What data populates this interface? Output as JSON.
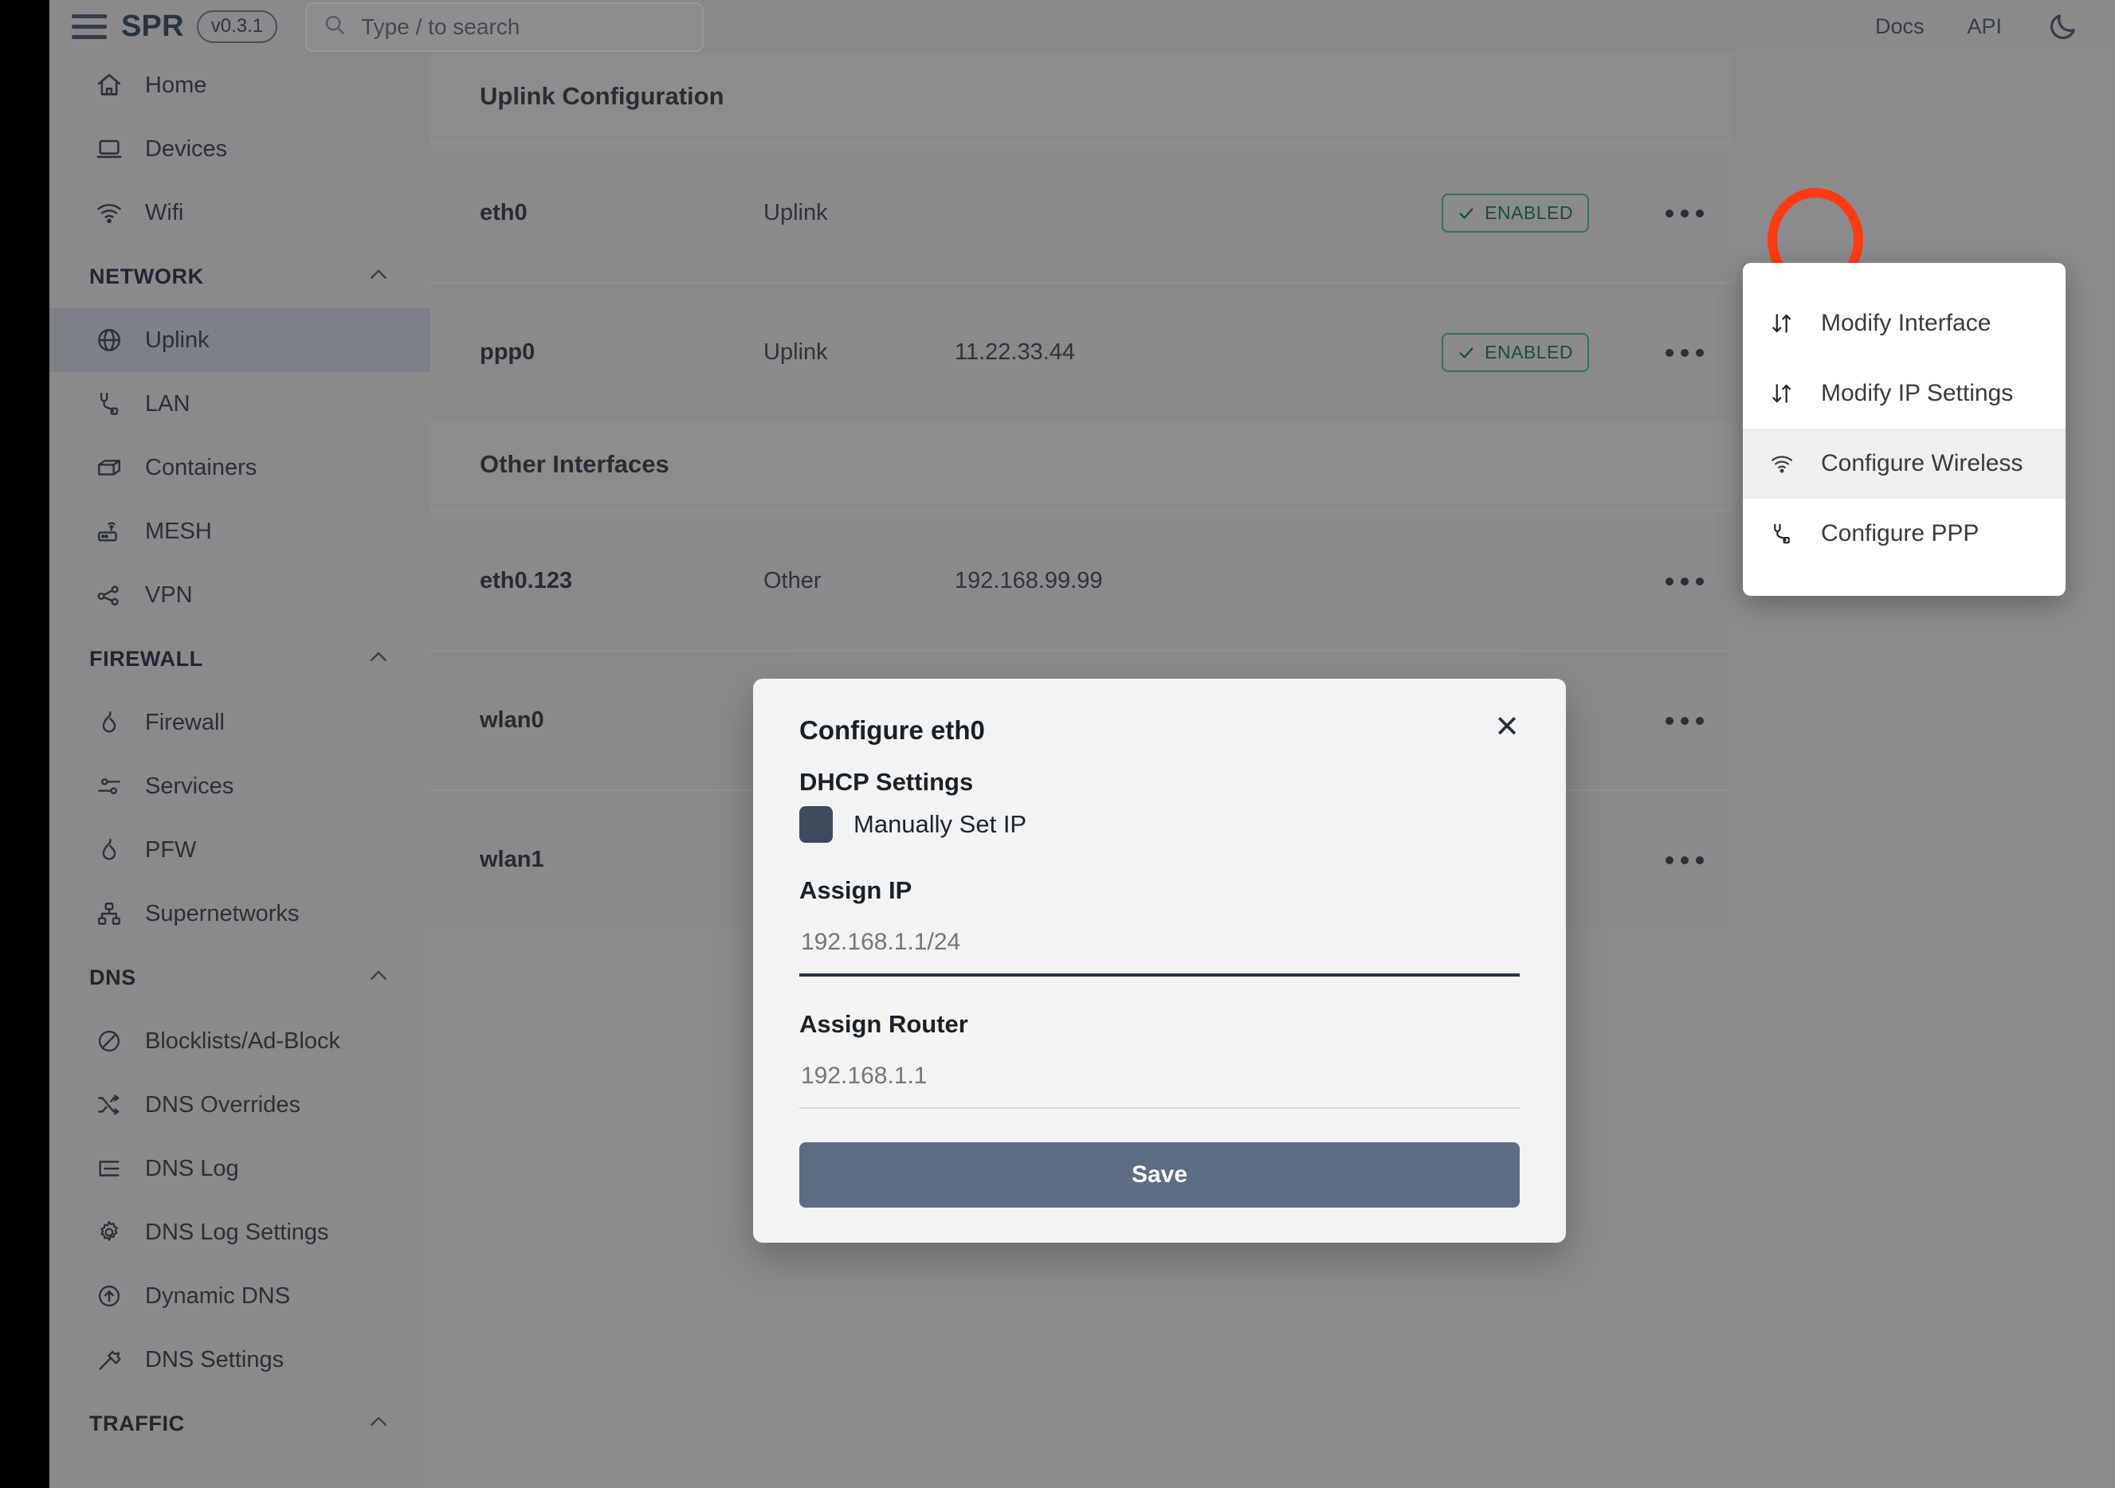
{
  "header": {
    "brand": "SPR",
    "version": "v0.3.1",
    "search_placeholder": "Type / to search",
    "links": [
      "Docs",
      "API"
    ],
    "theme_toggle_icon": "moon-icon",
    "menu_icon": "hamburger-icon",
    "search_icon": "search-icon"
  },
  "sidebar": {
    "top_items": [
      {
        "label": "Home",
        "icon": "home-icon"
      },
      {
        "label": "Devices",
        "icon": "laptop-icon"
      },
      {
        "label": "Wifi",
        "icon": "wifi-icon"
      }
    ],
    "groups": [
      {
        "title": "NETWORK",
        "collapse_icon": "chevron-up-icon",
        "items": [
          {
            "label": "Uplink",
            "icon": "globe-icon",
            "active": true
          },
          {
            "label": "LAN",
            "icon": "plug-icon",
            "active": false
          },
          {
            "label": "Containers",
            "icon": "box-icon",
            "active": false
          },
          {
            "label": "MESH",
            "icon": "router-icon",
            "active": false
          },
          {
            "label": "VPN",
            "icon": "share-nodes-icon",
            "active": false
          }
        ]
      },
      {
        "title": "FIREWALL",
        "collapse_icon": "chevron-up-icon",
        "items": [
          {
            "label": "Firewall",
            "icon": "flame-icon",
            "active": false
          },
          {
            "label": "Services",
            "icon": "sliders-icon",
            "active": false
          },
          {
            "label": "PFW",
            "icon": "flame-icon",
            "active": false
          },
          {
            "label": "Supernetworks",
            "icon": "network-tree-icon",
            "active": false
          }
        ]
      },
      {
        "title": "DNS",
        "collapse_icon": "chevron-up-icon",
        "items": [
          {
            "label": "Blocklists/Ad-Block",
            "icon": "block-icon",
            "active": false
          },
          {
            "label": "DNS Overrides",
            "icon": "shuffle-icon",
            "active": false
          },
          {
            "label": "DNS Log",
            "icon": "list-icon",
            "active": false
          },
          {
            "label": "DNS Log Settings",
            "icon": "gear-icon",
            "active": false
          },
          {
            "label": "Dynamic DNS",
            "icon": "arrow-up-circle-icon",
            "active": false
          },
          {
            "label": "DNS Settings",
            "icon": "hammer-icon",
            "active": false
          }
        ]
      },
      {
        "title": "TRAFFIC",
        "collapse_icon": "chevron-up-icon",
        "items": []
      }
    ]
  },
  "main": {
    "uplink_section_title": "Uplink Configuration",
    "other_section_title": "Other Interfaces",
    "uplink_rows": [
      {
        "name": "eth0",
        "type": "Uplink",
        "ip": "",
        "status": "ENABLED",
        "status_icon": "check-icon"
      },
      {
        "name": "ppp0",
        "type": "Uplink",
        "ip": "11.22.33.44",
        "status": "ENABLED",
        "status_icon": "check-icon"
      }
    ],
    "other_rows": [
      {
        "name": "eth0.123",
        "type": "Other",
        "ip": "192.168.99.99",
        "status": "",
        "status_icon": ""
      },
      {
        "name": "wlan0",
        "type": "",
        "ip": "",
        "status": "",
        "status_icon": ""
      },
      {
        "name": "wlan1",
        "type": "",
        "ip": "",
        "status": "",
        "status_icon": ""
      }
    ],
    "row_menu_icon": "ellipsis-icon"
  },
  "dropdown": {
    "items": [
      {
        "label": "Modify Interface",
        "icon": "updown-arrows-icon",
        "highlighted": false
      },
      {
        "label": "Modify IP Settings",
        "icon": "updown-arrows-icon",
        "highlighted": false
      },
      {
        "label": "Configure Wireless",
        "icon": "wifi-icon",
        "highlighted": true
      },
      {
        "label": "Configure PPP",
        "icon": "plug-icon",
        "highlighted": false
      }
    ]
  },
  "modal": {
    "title": "Configure eth0",
    "close_icon": "close-icon",
    "dhcp_heading": "DHCP Settings",
    "manual_ip_label": "Manually Set IP",
    "assign_ip_label": "Assign IP",
    "assign_ip_value": "",
    "assign_ip_placeholder": "192.168.1.1/24",
    "assign_router_label": "Assign Router",
    "assign_router_value": "",
    "assign_router_placeholder": "192.168.1.1",
    "save_label": "Save"
  },
  "annotation": {
    "highlight_color": "#ff3b14",
    "target": "row-menu-ellipsis-eth0"
  },
  "colors": {
    "accent_button": "#5d6b85",
    "checkbox": "#3d4a5e",
    "badge_text": "#1d4c33",
    "badge_border": "#3f6e52"
  }
}
